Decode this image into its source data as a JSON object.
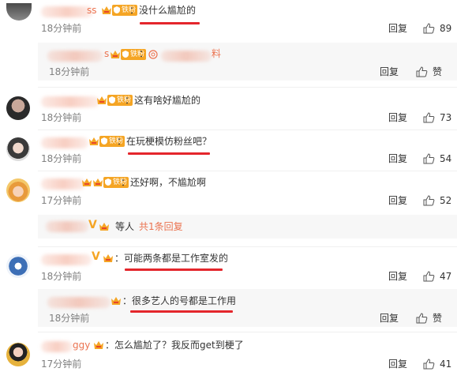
{
  "comments": [
    {
      "name": "ss",
      "badge": "铁粉",
      "content": "：没什么尴尬的",
      "time": "18分钟前",
      "reply": "回复",
      "likes": "89"
    },
    {
      "name": "s",
      "badge": "铁粉",
      "content": "：",
      "content_tail": "料",
      "time": "18分钟前",
      "reply": "回复",
      "likes": "赞"
    },
    {
      "badge": "铁粉",
      "content": "：这有啥好尴尬的",
      "time": "18分钟前",
      "reply": "回复",
      "likes": "73"
    },
    {
      "badge": "铁粉",
      "content": "：在玩梗模仿粉丝吧？",
      "time": "18分钟前",
      "reply": "回复",
      "likes": "54"
    },
    {
      "badge": "铁粉",
      "content": "：还好啊，不尴尬啊",
      "time": "17分钟前",
      "reply": "回复",
      "likes": "52",
      "sub_summary": {
        "tail": "等人",
        "link": "共1条回复"
      }
    },
    {
      "content": "：可能两条都是工作室发的",
      "time": "18分钟前",
      "reply": "回复",
      "likes": "47"
    },
    {
      "content": "：很多艺人的号都是工作用",
      "time": "18分钟前",
      "reply": "回复",
      "likes": "赞"
    },
    {
      "name": "ggy",
      "content": "：怎么尴尬了？我反而get到梗了",
      "time": "17分钟前",
      "reply": "回复",
      "likes": "41"
    }
  ],
  "colors": {
    "username": "#eb7350",
    "badge": "#f5a524",
    "underline": "#e4262c",
    "meta": "#808080"
  },
  "icons": [
    "crown-icon",
    "fan-badge-icon",
    "thumbs-up-icon"
  ]
}
